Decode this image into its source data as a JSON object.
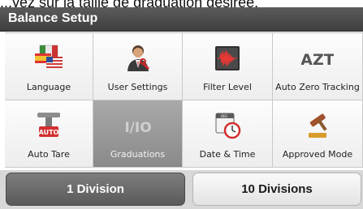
{
  "overlay_text": "...yez sur la taille de graduation désirée.",
  "header": {
    "title": "Balance Setup"
  },
  "tiles": [
    {
      "label": "Language",
      "icon": "flags-icon"
    },
    {
      "label": "User Settings",
      "icon": "user-settings-icon"
    },
    {
      "label": "Filter Level",
      "icon": "filter-level-icon"
    },
    {
      "label": "Auto Zero Tracking",
      "icon": "azt-icon",
      "icon_text": "AZT"
    },
    {
      "label": "Auto Tare",
      "icon": "auto-tare-icon",
      "icon_text": "AUTO"
    },
    {
      "label": "Graduations",
      "icon": "graduations-icon",
      "icon_text": "I/IO",
      "selected": true
    },
    {
      "label": "Date & Time",
      "icon": "calendar-clock-icon",
      "icon_text": "DEC"
    },
    {
      "label": "Approved Mode",
      "icon": "gavel-icon"
    }
  ],
  "buttons": {
    "one_division": "1 Division",
    "ten_divisions": "10 Divisions"
  },
  "colors": {
    "header": "#4a4a4a",
    "selected_tile": "#9a9a9a",
    "tile": "#f5f5f5"
  }
}
